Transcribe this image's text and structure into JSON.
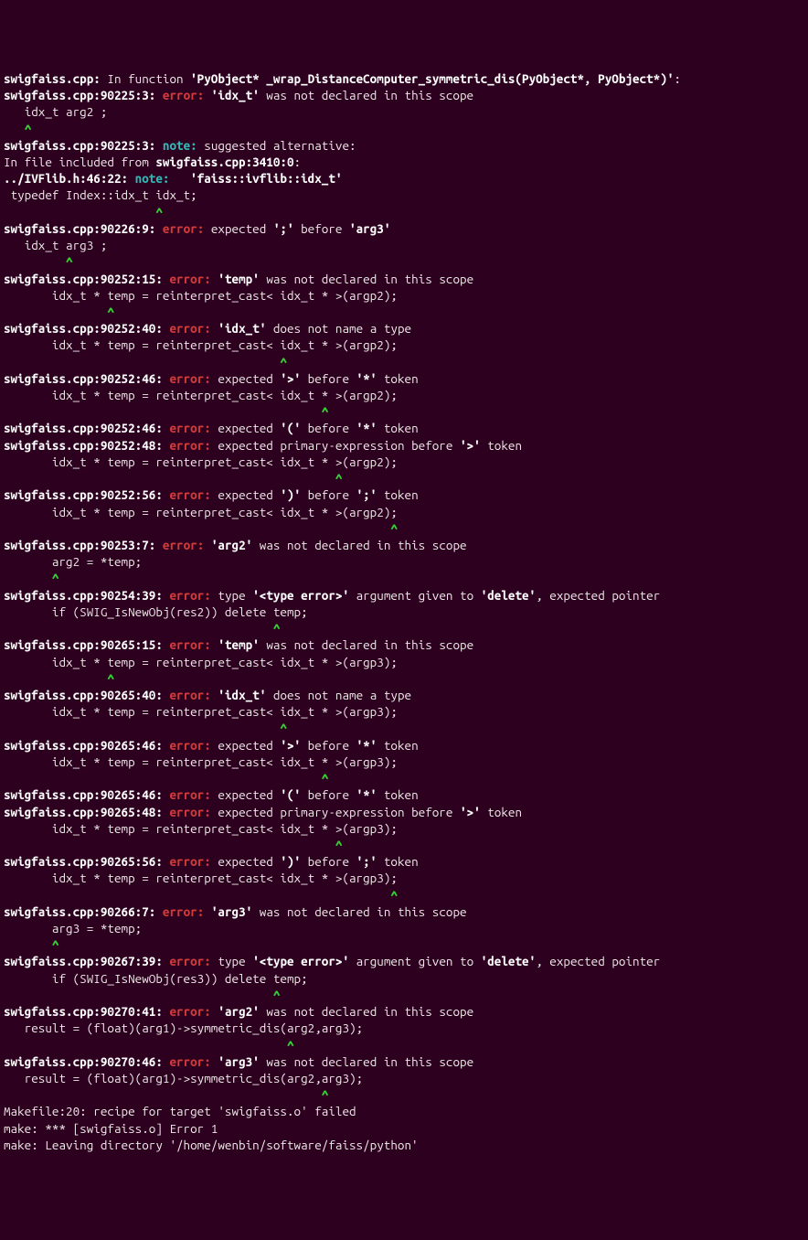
{
  "lines": [
    {
      "runs": [
        {
          "t": "swigfaiss.cpp:",
          "c": "b"
        },
        {
          "t": " In function "
        },
        {
          "t": "'PyObject* _wrap_DistanceComputer_symmetric_dis(PyObject*, PyObject*)'",
          "c": "q"
        },
        {
          "t": ":"
        }
      ]
    },
    {
      "runs": [
        {
          "t": "swigfaiss.cpp:90225:3: ",
          "c": "b"
        },
        {
          "t": "error:",
          "c": "err"
        },
        {
          "t": " "
        },
        {
          "t": "'idx_t'",
          "c": "q"
        },
        {
          "t": " was not declared in this scope"
        }
      ]
    },
    {
      "runs": [
        {
          "t": "   idx_t arg2 ;"
        }
      ]
    },
    {
      "runs": [
        {
          "t": "   ^",
          "c": "caret"
        }
      ]
    },
    {
      "runs": [
        {
          "t": "swigfaiss.cpp:90225:3: ",
          "c": "b"
        },
        {
          "t": "note:",
          "c": "note"
        },
        {
          "t": " suggested alternative:"
        }
      ]
    },
    {
      "runs": [
        {
          "t": "In file included from "
        },
        {
          "t": "swigfaiss.cpp:3410:0",
          "c": "b"
        },
        {
          "t": ":"
        }
      ]
    },
    {
      "runs": [
        {
          "t": "../IVFlib.h:46:22: ",
          "c": "b"
        },
        {
          "t": "note:",
          "c": "note"
        },
        {
          "t": "   "
        },
        {
          "t": "'faiss::ivflib::idx_t'",
          "c": "q"
        }
      ]
    },
    {
      "runs": [
        {
          "t": " typedef Index::idx_t idx_t;"
        }
      ]
    },
    {
      "runs": [
        {
          "t": "                      ^",
          "c": "caret"
        }
      ]
    },
    {
      "runs": [
        {
          "t": "swigfaiss.cpp:90226:9: ",
          "c": "b"
        },
        {
          "t": "error:",
          "c": "err"
        },
        {
          "t": " expected "
        },
        {
          "t": "';'",
          "c": "q"
        },
        {
          "t": " before "
        },
        {
          "t": "'arg3'",
          "c": "q"
        }
      ]
    },
    {
      "runs": [
        {
          "t": "   idx_t arg3 ;"
        }
      ]
    },
    {
      "runs": [
        {
          "t": "         ^",
          "c": "caret"
        }
      ]
    },
    {
      "runs": [
        {
          "t": "swigfaiss.cpp:90252:15: ",
          "c": "b"
        },
        {
          "t": "error:",
          "c": "err"
        },
        {
          "t": " "
        },
        {
          "t": "'temp'",
          "c": "q"
        },
        {
          "t": " was not declared in this scope"
        }
      ]
    },
    {
      "runs": [
        {
          "t": "       idx_t * temp = reinterpret_cast< idx_t * >(argp2);"
        }
      ]
    },
    {
      "runs": [
        {
          "t": "               ^",
          "c": "caret"
        }
      ]
    },
    {
      "runs": [
        {
          "t": "swigfaiss.cpp:90252:40: ",
          "c": "b"
        },
        {
          "t": "error:",
          "c": "err"
        },
        {
          "t": " "
        },
        {
          "t": "'idx_t'",
          "c": "q"
        },
        {
          "t": " does not name a type"
        }
      ]
    },
    {
      "runs": [
        {
          "t": "       idx_t * temp = reinterpret_cast< idx_t * >(argp2);"
        }
      ]
    },
    {
      "runs": [
        {
          "t": "                                        ^",
          "c": "caret"
        }
      ]
    },
    {
      "runs": [
        {
          "t": "swigfaiss.cpp:90252:46: ",
          "c": "b"
        },
        {
          "t": "error:",
          "c": "err"
        },
        {
          "t": " expected "
        },
        {
          "t": "'>'",
          "c": "q"
        },
        {
          "t": " before "
        },
        {
          "t": "'*'",
          "c": "q"
        },
        {
          "t": " token"
        }
      ]
    },
    {
      "runs": [
        {
          "t": "       idx_t * temp = reinterpret_cast< idx_t * >(argp2);"
        }
      ]
    },
    {
      "runs": [
        {
          "t": "                                              ^",
          "c": "caret"
        }
      ]
    },
    {
      "runs": [
        {
          "t": "swigfaiss.cpp:90252:46: ",
          "c": "b"
        },
        {
          "t": "error:",
          "c": "err"
        },
        {
          "t": " expected "
        },
        {
          "t": "'('",
          "c": "q"
        },
        {
          "t": " before "
        },
        {
          "t": "'*'",
          "c": "q"
        },
        {
          "t": " token"
        }
      ]
    },
    {
      "runs": [
        {
          "t": "swigfaiss.cpp:90252:48: ",
          "c": "b"
        },
        {
          "t": "error:",
          "c": "err"
        },
        {
          "t": " expected primary-expression before "
        },
        {
          "t": "'>'",
          "c": "q"
        },
        {
          "t": " token"
        }
      ]
    },
    {
      "runs": [
        {
          "t": "       idx_t * temp = reinterpret_cast< idx_t * >(argp2);"
        }
      ]
    },
    {
      "runs": [
        {
          "t": "                                                ^",
          "c": "caret"
        }
      ]
    },
    {
      "runs": [
        {
          "t": "swigfaiss.cpp:90252:56: ",
          "c": "b"
        },
        {
          "t": "error:",
          "c": "err"
        },
        {
          "t": " expected "
        },
        {
          "t": "')'",
          "c": "q"
        },
        {
          "t": " before "
        },
        {
          "t": "';'",
          "c": "q"
        },
        {
          "t": " token"
        }
      ]
    },
    {
      "runs": [
        {
          "t": "       idx_t * temp = reinterpret_cast< idx_t * >(argp2);"
        }
      ]
    },
    {
      "runs": [
        {
          "t": "                                                        ^",
          "c": "caret"
        }
      ]
    },
    {
      "runs": [
        {
          "t": "swigfaiss.cpp:90253:7: ",
          "c": "b"
        },
        {
          "t": "error:",
          "c": "err"
        },
        {
          "t": " "
        },
        {
          "t": "'arg2'",
          "c": "q"
        },
        {
          "t": " was not declared in this scope"
        }
      ]
    },
    {
      "runs": [
        {
          "t": "       arg2 = *temp;"
        }
      ]
    },
    {
      "runs": [
        {
          "t": "       ^",
          "c": "caret"
        }
      ]
    },
    {
      "runs": [
        {
          "t": "swigfaiss.cpp:90254:39: ",
          "c": "b"
        },
        {
          "t": "error:",
          "c": "err"
        },
        {
          "t": " type "
        },
        {
          "t": "'<type error>'",
          "c": "q"
        },
        {
          "t": " argument given to "
        },
        {
          "t": "'delete'",
          "c": "q"
        },
        {
          "t": ", expected pointer"
        }
      ]
    },
    {
      "runs": [
        {
          "t": "       if (SWIG_IsNewObj(res2)) delete temp;"
        }
      ]
    },
    {
      "runs": [
        {
          "t": "                                       ^",
          "c": "caret"
        }
      ]
    },
    {
      "runs": [
        {
          "t": "swigfaiss.cpp:90265:15: ",
          "c": "b"
        },
        {
          "t": "error:",
          "c": "err"
        },
        {
          "t": " "
        },
        {
          "t": "'temp'",
          "c": "q"
        },
        {
          "t": " was not declared in this scope"
        }
      ]
    },
    {
      "runs": [
        {
          "t": "       idx_t * temp = reinterpret_cast< idx_t * >(argp3);"
        }
      ]
    },
    {
      "runs": [
        {
          "t": "               ^",
          "c": "caret"
        }
      ]
    },
    {
      "runs": [
        {
          "t": "swigfaiss.cpp:90265:40: ",
          "c": "b"
        },
        {
          "t": "error:",
          "c": "err"
        },
        {
          "t": " "
        },
        {
          "t": "'idx_t'",
          "c": "q"
        },
        {
          "t": " does not name a type"
        }
      ]
    },
    {
      "runs": [
        {
          "t": "       idx_t * temp = reinterpret_cast< idx_t * >(argp3);"
        }
      ]
    },
    {
      "runs": [
        {
          "t": "                                        ^",
          "c": "caret"
        }
      ]
    },
    {
      "runs": [
        {
          "t": "swigfaiss.cpp:90265:46: ",
          "c": "b"
        },
        {
          "t": "error:",
          "c": "err"
        },
        {
          "t": " expected "
        },
        {
          "t": "'>'",
          "c": "q"
        },
        {
          "t": " before "
        },
        {
          "t": "'*'",
          "c": "q"
        },
        {
          "t": " token"
        }
      ]
    },
    {
      "runs": [
        {
          "t": "       idx_t * temp = reinterpret_cast< idx_t * >(argp3);"
        }
      ]
    },
    {
      "runs": [
        {
          "t": "                                              ^",
          "c": "caret"
        }
      ]
    },
    {
      "runs": [
        {
          "t": "swigfaiss.cpp:90265:46: ",
          "c": "b"
        },
        {
          "t": "error:",
          "c": "err"
        },
        {
          "t": " expected "
        },
        {
          "t": "'('",
          "c": "q"
        },
        {
          "t": " before "
        },
        {
          "t": "'*'",
          "c": "q"
        },
        {
          "t": " token"
        }
      ]
    },
    {
      "runs": [
        {
          "t": "swigfaiss.cpp:90265:48: ",
          "c": "b"
        },
        {
          "t": "error:",
          "c": "err"
        },
        {
          "t": " expected primary-expression before "
        },
        {
          "t": "'>'",
          "c": "q"
        },
        {
          "t": " token"
        }
      ]
    },
    {
      "runs": [
        {
          "t": "       idx_t * temp = reinterpret_cast< idx_t * >(argp3);"
        }
      ]
    },
    {
      "runs": [
        {
          "t": "                                                ^",
          "c": "caret"
        }
      ]
    },
    {
      "runs": [
        {
          "t": "swigfaiss.cpp:90265:56: ",
          "c": "b"
        },
        {
          "t": "error:",
          "c": "err"
        },
        {
          "t": " expected "
        },
        {
          "t": "')'",
          "c": "q"
        },
        {
          "t": " before "
        },
        {
          "t": "';'",
          "c": "q"
        },
        {
          "t": " token"
        }
      ]
    },
    {
      "runs": [
        {
          "t": "       idx_t * temp = reinterpret_cast< idx_t * >(argp3);"
        }
      ]
    },
    {
      "runs": [
        {
          "t": "                                                        ^",
          "c": "caret"
        }
      ]
    },
    {
      "runs": [
        {
          "t": "swigfaiss.cpp:90266:7: ",
          "c": "b"
        },
        {
          "t": "error:",
          "c": "err"
        },
        {
          "t": " "
        },
        {
          "t": "'arg3'",
          "c": "q"
        },
        {
          "t": " was not declared in this scope"
        }
      ]
    },
    {
      "runs": [
        {
          "t": "       arg3 = *temp;"
        }
      ]
    },
    {
      "runs": [
        {
          "t": "       ^",
          "c": "caret"
        }
      ]
    },
    {
      "runs": [
        {
          "t": "swigfaiss.cpp:90267:39: ",
          "c": "b"
        },
        {
          "t": "error:",
          "c": "err"
        },
        {
          "t": " type "
        },
        {
          "t": "'<type error>'",
          "c": "q"
        },
        {
          "t": " argument given to "
        },
        {
          "t": "'delete'",
          "c": "q"
        },
        {
          "t": ", expected pointer"
        }
      ]
    },
    {
      "runs": [
        {
          "t": "       if (SWIG_IsNewObj(res3)) delete temp;"
        }
      ]
    },
    {
      "runs": [
        {
          "t": "                                       ^",
          "c": "caret"
        }
      ]
    },
    {
      "runs": [
        {
          "t": "swigfaiss.cpp:90270:41: ",
          "c": "b"
        },
        {
          "t": "error:",
          "c": "err"
        },
        {
          "t": " "
        },
        {
          "t": "'arg2'",
          "c": "q"
        },
        {
          "t": " was not declared in this scope"
        }
      ]
    },
    {
      "runs": [
        {
          "t": "   result = (float)(arg1)->symmetric_dis(arg2,arg3);"
        }
      ]
    },
    {
      "runs": [
        {
          "t": "                                         ^",
          "c": "caret"
        }
      ]
    },
    {
      "runs": [
        {
          "t": "swigfaiss.cpp:90270:46: ",
          "c": "b"
        },
        {
          "t": "error:",
          "c": "err"
        },
        {
          "t": " "
        },
        {
          "t": "'arg3'",
          "c": "q"
        },
        {
          "t": " was not declared in this scope"
        }
      ]
    },
    {
      "runs": [
        {
          "t": "   result = (float)(arg1)->symmetric_dis(arg2,arg3);"
        }
      ]
    },
    {
      "runs": [
        {
          "t": "                                              ^",
          "c": "caret"
        }
      ]
    },
    {
      "runs": [
        {
          "t": "Makefile:20: recipe for target 'swigfaiss.o' failed"
        }
      ]
    },
    {
      "runs": [
        {
          "t": "make: *** [swigfaiss.o] Error 1"
        }
      ]
    },
    {
      "runs": [
        {
          "t": "make: Leaving directory '/home/wenbin/software/faiss/python'"
        }
      ]
    }
  ]
}
